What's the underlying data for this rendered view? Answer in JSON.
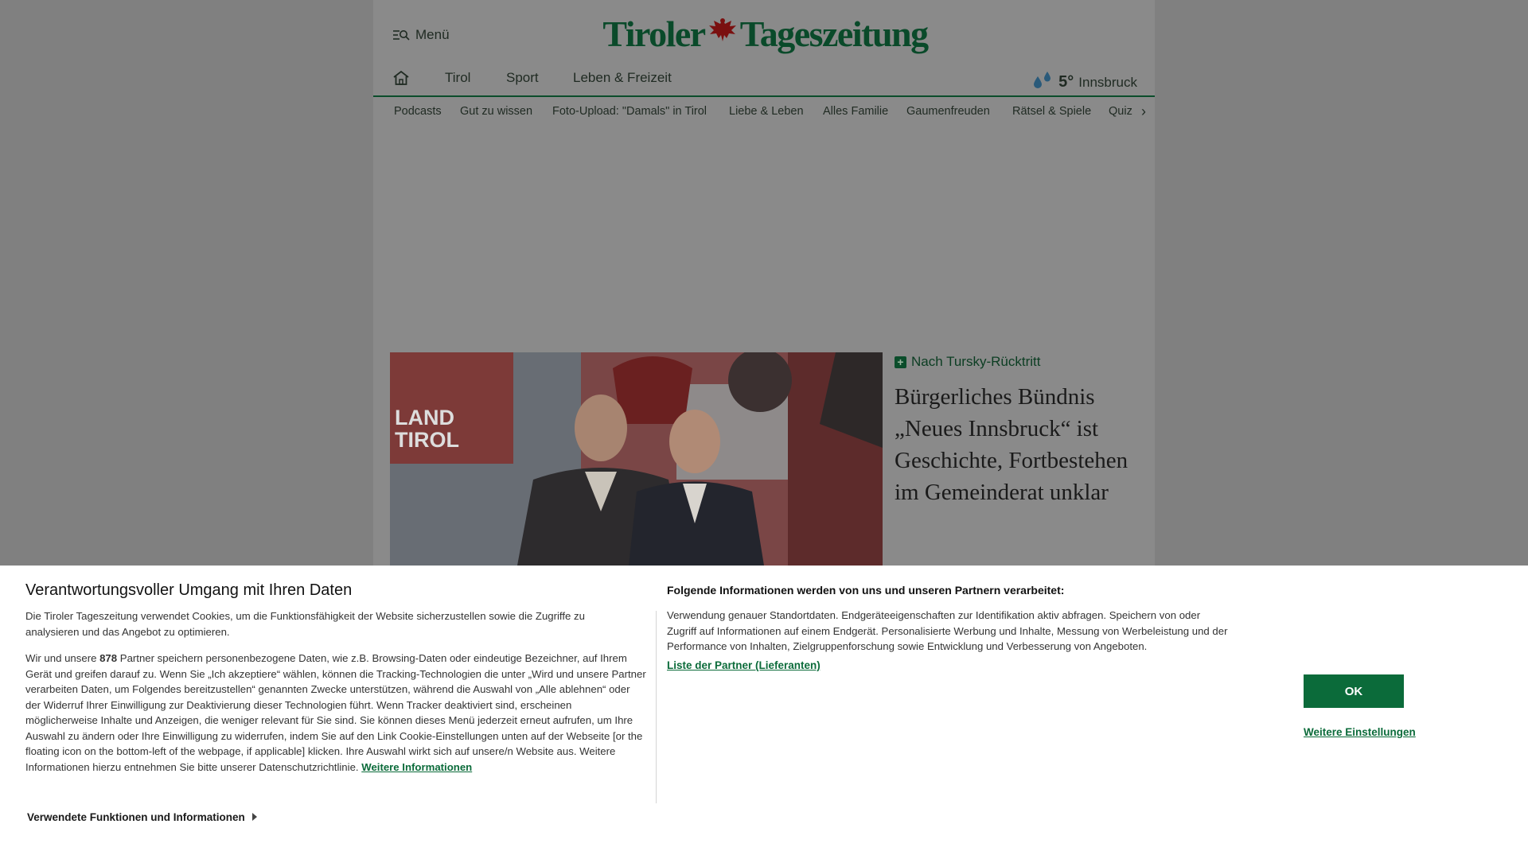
{
  "header": {
    "menu_label": "Menü",
    "logo_text_left": "Tiroler",
    "logo_text_right": "Tageszeitung"
  },
  "main_nav": {
    "items": [
      "Tirol",
      "Sport",
      "Leben & Freizeit"
    ],
    "weather": {
      "temperature": "5°",
      "city": "Innsbruck"
    }
  },
  "sub_nav": {
    "items": [
      "Podcasts",
      "Gut zu wissen",
      "Foto-Upload: \"Damals\" in Tirol",
      "Liebe & Leben",
      "Alles Familie",
      "Gaumenfreuden",
      "Rätsel & Spiele",
      "Quiz"
    ]
  },
  "hero": {
    "image_sign_line1": "LAND",
    "image_sign_line2": "TIROL",
    "kicker": "Nach Tursky-Rücktritt",
    "headline": "Bürgerliches Bündnis „Neues Innsbruck“ ist Geschichte, Fortbestehen im Gemeinderat unklar"
  },
  "consent": {
    "title": "Verantwortungsvoller Umgang mit Ihren Daten",
    "intro": "Die Tiroler Tageszeitung verwendet Cookies, um die Funktionsfähigkeit der Website sicherzustellen sowie die Zugriffe zu analysieren und das Angebot zu optimieren.",
    "partners_prefix": "Wir und unsere ",
    "partners_count": "878",
    "partners_text": " Partner speichern personenbezogene Daten, wie z.B. Browsing-Daten oder eindeutige Bezeichner, auf Ihrem Gerät und greifen darauf zu. Wenn Sie „Ich akzeptiere“ wählen, können die Tracking-Technologien die unter „Wird und unsere Partner verarbeiten Daten, um Folgendes bereitzustellen“ genannten Zwecke unterstützen, während die Auswahl von „Alle ablehnen“ oder der Widerruf Ihrer Einwilligung zur Deaktivierung dieser Technologien führt. Wenn Tracker deaktiviert sind, erscheinen möglicherweise Inhalte und Anzeigen, die weniger relevant für Sie sind. Sie können dieses Menü jederzeit erneut aufrufen, um Ihre Auswahl zu ändern oder Ihre Einwilligung zu widerrufen, indem Sie auf den Link Cookie-Einstellungen unten auf der Webseite [or the floating icon on the bottom-left of the webpage, if applicable] klicken. Ihre Auswahl wirkt sich auf unsere/n Website aus. Weitere Informationen hierzu entnehmen Sie bitte unserer Datenschutzrichtlinie. ",
    "more_info_link": "Weitere Informationen",
    "expand_label": "Verwendete Funktionen und Informationen",
    "right_title": "Folgende Informationen werden von uns und unseren Partnern verarbeitet:",
    "right_text": "Verwendung genauer Standortdaten. Endgeräteeigenschaften zur Identifikation aktiv abfragen. Speichern von oder Zugriff auf Informationen auf einem Endgerät. Personalisierte Werbung und Inhalte, Messung von Werbeleistung und der Performance von Inhalten, Zielgruppenforschung sowie Entwicklung und Verbesserung von Angeboten.",
    "partner_list_link": "Liste der Partner (Lieferanten)",
    "ok_label": "OK",
    "settings_label": "Weitere Einstellungen"
  }
}
